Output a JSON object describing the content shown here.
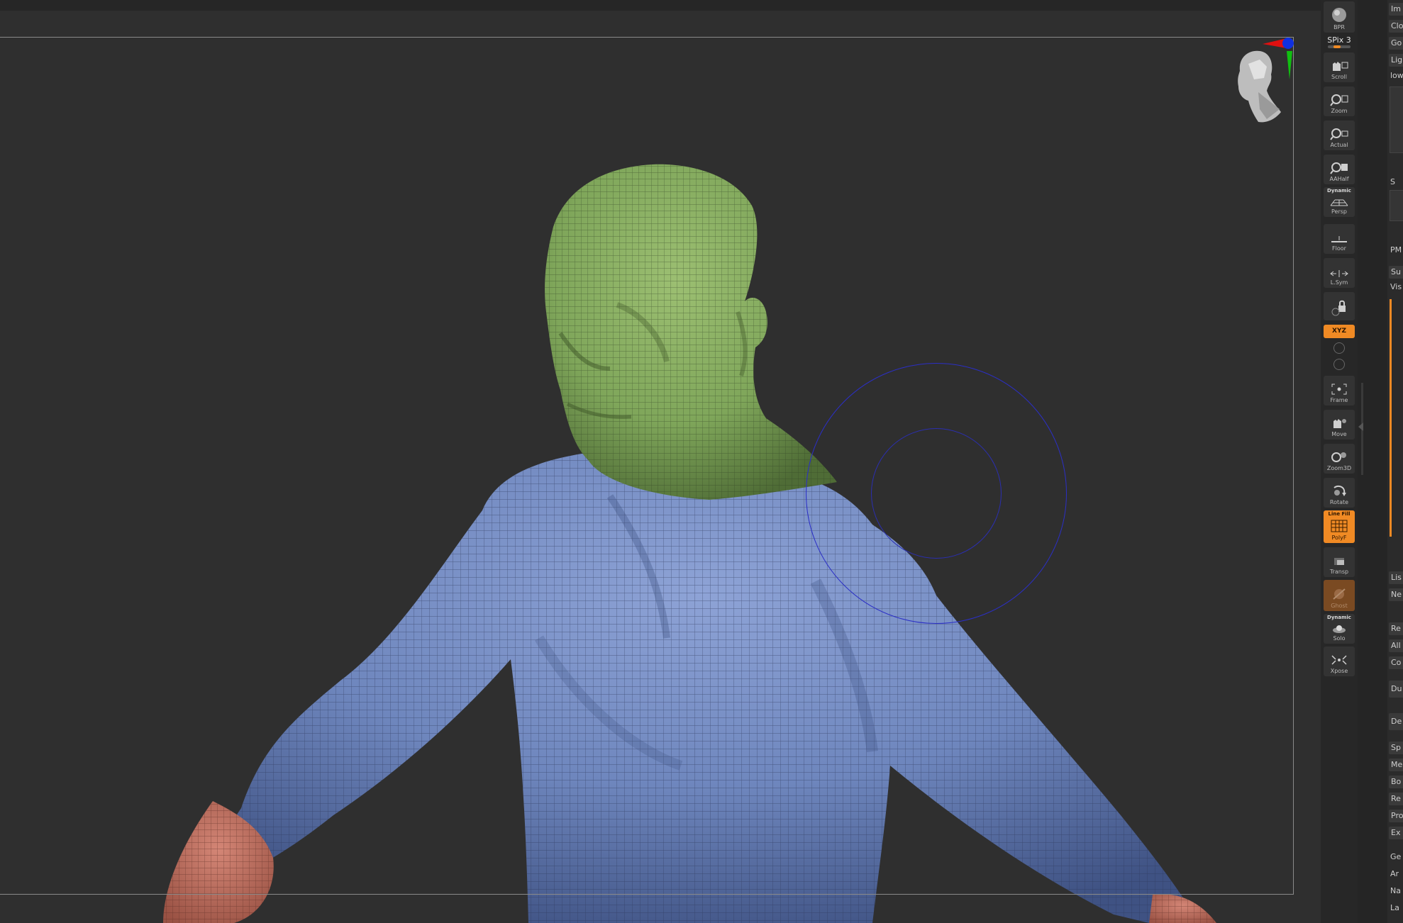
{
  "shelf": {
    "bpr": "BPR",
    "spix": "SPix 3",
    "scroll": "Scroll",
    "zoom": "Zoom",
    "actual": "Actual",
    "aahalf": "AAHalf",
    "persp_top": "Dynamic",
    "persp": "Persp",
    "floor": "Floor",
    "lsym": "L.Sym",
    "xyz": "XYZ",
    "frame": "Frame",
    "move": "Move",
    "zoom3d": "Zoom3D",
    "rotate": "Rotate",
    "polyf_top": "Line Fill",
    "polyf": "PolyF",
    "transp": "Transp",
    "ghost": "Ghost",
    "solo_top": "Dynamic",
    "solo": "Solo",
    "xpose": "Xpose"
  },
  "palette": {
    "items": [
      "Im",
      "Clo",
      "Go",
      "Lig",
      "low",
      "S",
      "PM",
      "Su",
      "Vis",
      "Lis",
      "Ne",
      "Re",
      "All",
      "Co",
      "Du",
      "De",
      "Sp",
      "Me",
      "Bo",
      "Re",
      "Pro",
      "Ex",
      "Ge",
      "Ar",
      "Na",
      "La"
    ]
  },
  "colors": {
    "accent": "#f08a24",
    "head_polygroup": "#7fa65a",
    "body_polygroup": "#6e86bd",
    "hand_polygroup": "#c2705f",
    "brush_circle": "#2b2fc6"
  }
}
